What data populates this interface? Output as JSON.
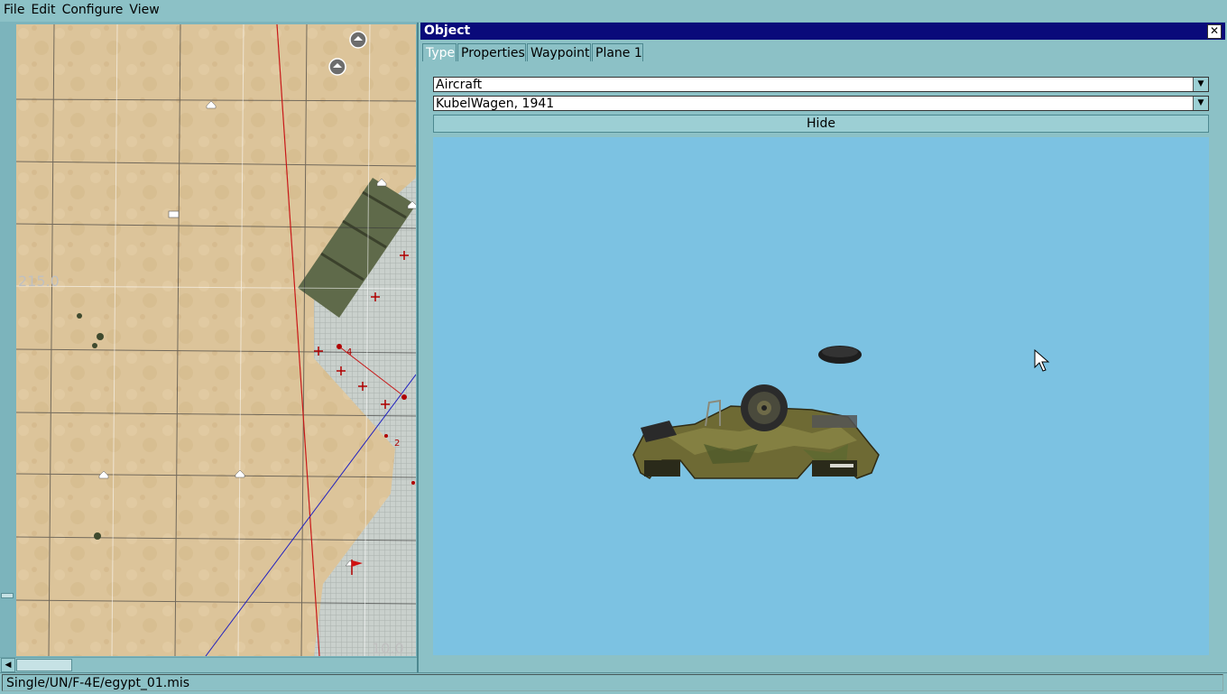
{
  "menu": [
    "File",
    "Edit",
    "Configure",
    "View"
  ],
  "map": {
    "grid_label_top": "215.0",
    "grid_label_bottom": "10.0",
    "waypoint_labels": [
      "4",
      "2"
    ]
  },
  "object_panel": {
    "title": "Object",
    "close_icon": "close-icon",
    "tabs": [
      "Type",
      "Properties",
      "Waypoint",
      "Plane 1"
    ],
    "active_tab": "Type",
    "category_value": "Aircraft",
    "type_value": "KubelWagen, 1941",
    "hide_label": "Hide",
    "preview_background": "#7cc2e2"
  },
  "status": {
    "path": "Single/UN/F-4E/egypt_01.mis"
  },
  "colors": {
    "titlebar": "#0a0a7a",
    "ui_background": "#8cc1c6",
    "map_sand": "#dcc49a"
  }
}
